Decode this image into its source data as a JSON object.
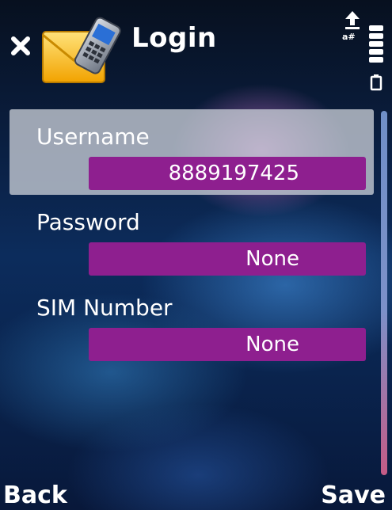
{
  "header": {
    "title": "Login",
    "close_icon": "close-icon",
    "app_icon": "envelope-phone-icon",
    "status_icon": "data-transfer-icon",
    "signal_icon": "signal-strength-icon",
    "battery_icon": "battery-icon"
  },
  "fields": [
    {
      "label": "Username",
      "value": "8889197425"
    },
    {
      "label": "Password",
      "value": "None"
    },
    {
      "label": "SIM Number",
      "value": "None"
    }
  ],
  "softkeys": {
    "left": "Back",
    "right": "Save"
  },
  "colors": {
    "field_value_bg": "#8e1f8f",
    "selected_row_bg": "#c8cdd6",
    "background": "#0a1d3d"
  }
}
